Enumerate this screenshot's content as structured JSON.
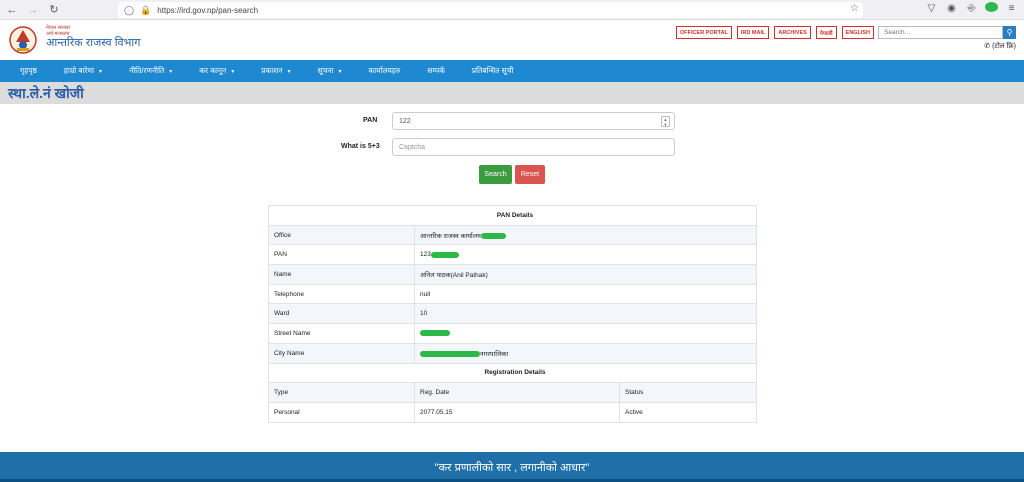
{
  "browser": {
    "url": "https://ird.gov.np/pan-search"
  },
  "header": {
    "logo_small_line1": "नेपाल सरकार",
    "logo_small_line2": "अर्थ मन्त्रालय",
    "logo_title": "आन्तरिक राजस्व विभाग",
    "top_links": [
      "OFFICER PORTAL",
      "IRD MAIL",
      "ARCHIVES",
      "नेपाली",
      "ENGLISH"
    ],
    "search_placeholder": "Search...",
    "toll_free": "(टोल फ्रि)"
  },
  "nav": {
    "items": [
      {
        "label": "गृहपृष्ठ",
        "dropdown": false
      },
      {
        "label": "हाम्रो बारेमा",
        "dropdown": true
      },
      {
        "label": "नीति/रणनीति",
        "dropdown": true
      },
      {
        "label": "कर कानून",
        "dropdown": true
      },
      {
        "label": "प्रकाशन",
        "dropdown": true
      },
      {
        "label": "सूचना",
        "dropdown": true
      },
      {
        "label": "कार्यालयहरु",
        "dropdown": false
      },
      {
        "label": "सम्पर्क",
        "dropdown": false
      },
      {
        "label": "प्रतिबन्धित सूची",
        "dropdown": false
      }
    ]
  },
  "page": {
    "title": "स्था.ले.नं खोजी"
  },
  "form": {
    "pan_label": "PAN",
    "pan_value": "122",
    "captcha_label": "What is 5+3",
    "captcha_placeholder": "Captcha",
    "search_label": "Search",
    "reset_label": "Reset"
  },
  "details": {
    "pan_header": "PAN Details",
    "rows": [
      {
        "key": "Office",
        "value": "आन्तरिक राजस्व कार्यालय",
        "redact_after": true
      },
      {
        "key": "PAN",
        "value": "123",
        "redact_after": true
      },
      {
        "key": "Name",
        "value": "अनिल पाठक(Anil Pathak)",
        "redact_after": false
      },
      {
        "key": "Telephone",
        "value": "null",
        "redact_after": false
      },
      {
        "key": "Ward",
        "value": "10",
        "redact_after": false
      },
      {
        "key": "Street Name",
        "value": "",
        "redact_after": true
      },
      {
        "key": "City Name",
        "value": "नगरपालिका",
        "redact_before": true
      }
    ],
    "reg_header": "Registration Details",
    "reg_columns": [
      "Type",
      "Reg. Date",
      "Status"
    ],
    "reg_rows": [
      [
        "Personal",
        "2077.05.15",
        "Active"
      ]
    ]
  },
  "footer": {
    "slogan": "\"कर प्रणालीको सार , लगानीको आधार\""
  },
  "colors": {
    "nav_blue": "#1e88d0",
    "footer_blue": "#1f6fa8",
    "search_green": "#3a9b3f",
    "reset_red": "#d9534f",
    "redact_green": "#2db84a"
  }
}
